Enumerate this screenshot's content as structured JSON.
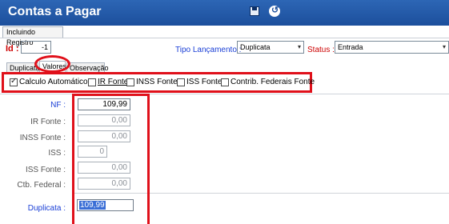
{
  "window": {
    "title": "Contas a Pagar"
  },
  "toolbar": {
    "save_icon": "save-icon",
    "undo_icon": "undo-icon"
  },
  "status_tab": "Incluindo Registro",
  "header": {
    "id_label": "Id :",
    "id_value": "-1",
    "tipo_label": "Tipo Lançamento :",
    "tipo_value": "Duplicata",
    "status_label": "Status :",
    "status_value": "Entrada"
  },
  "tabs": [
    {
      "label": "Duplicata"
    },
    {
      "label": "Valores"
    },
    {
      "label": "Observação"
    }
  ],
  "checks": [
    {
      "label": "Calculo Automático",
      "checked": true
    },
    {
      "label": "IR Fonte",
      "checked": false
    },
    {
      "label": "INSS Fonte",
      "checked": false
    },
    {
      "label": "ISS Fonte",
      "checked": false
    },
    {
      "label": "Contrib. Federais Fonte",
      "checked": false
    }
  ],
  "fields": {
    "nf": {
      "label": "NF :",
      "value": "109,99"
    },
    "ir_fonte": {
      "label": "IR Fonte :",
      "value": "0,00"
    },
    "inss_fonte": {
      "label": "INSS Fonte :",
      "value": "0,00"
    },
    "iss": {
      "label": "ISS :",
      "value": "0"
    },
    "iss_fonte": {
      "label": "ISS Fonte :",
      "value": "0,00"
    },
    "ctb_federal": {
      "label": "Ctb. Federal :",
      "value": "0,00"
    },
    "duplicata": {
      "label": "Duplicata :",
      "value": "109,99"
    }
  },
  "colors": {
    "title_bar": "#1c4f9c",
    "annotation": "#e0101a",
    "required_label": "#cc0000",
    "field_label": "#1a3fd6"
  }
}
